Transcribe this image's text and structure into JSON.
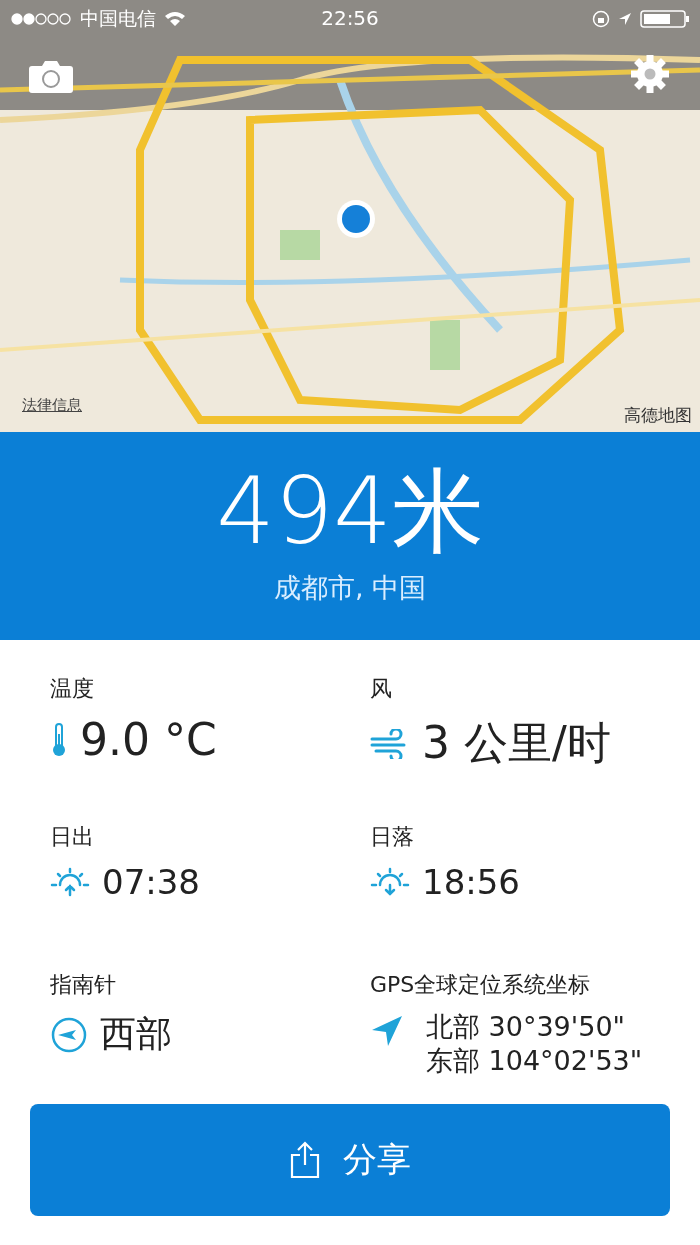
{
  "status_bar": {
    "carrier": "中国电信",
    "time": "22:56"
  },
  "map": {
    "kind": "picture",
    "legal_link": "法律信息",
    "attribution": "高德地图"
  },
  "altitude": {
    "value": "494米",
    "location": "成都市, 中国"
  },
  "stats": [
    {
      "kind": "temperature",
      "label": "温度",
      "values": [
        "9.0 °C"
      ]
    },
    {
      "kind": "wind",
      "label": "风",
      "values": [
        "3 公里/时"
      ]
    },
    {
      "kind": "sunrise",
      "label": "日出",
      "values": [
        "07:38"
      ]
    },
    {
      "kind": "sunset",
      "label": "日落",
      "values": [
        "18:56"
      ]
    },
    {
      "kind": "compass",
      "label": "指南针",
      "values": [
        "西部"
      ]
    },
    {
      "kind": "gps",
      "label": "GPS全球定位系统坐标",
      "values": [
        "北部 30°39'50\"",
        "东部 104°02'53\""
      ]
    }
  ],
  "share_button": {
    "label": "分享"
  }
}
